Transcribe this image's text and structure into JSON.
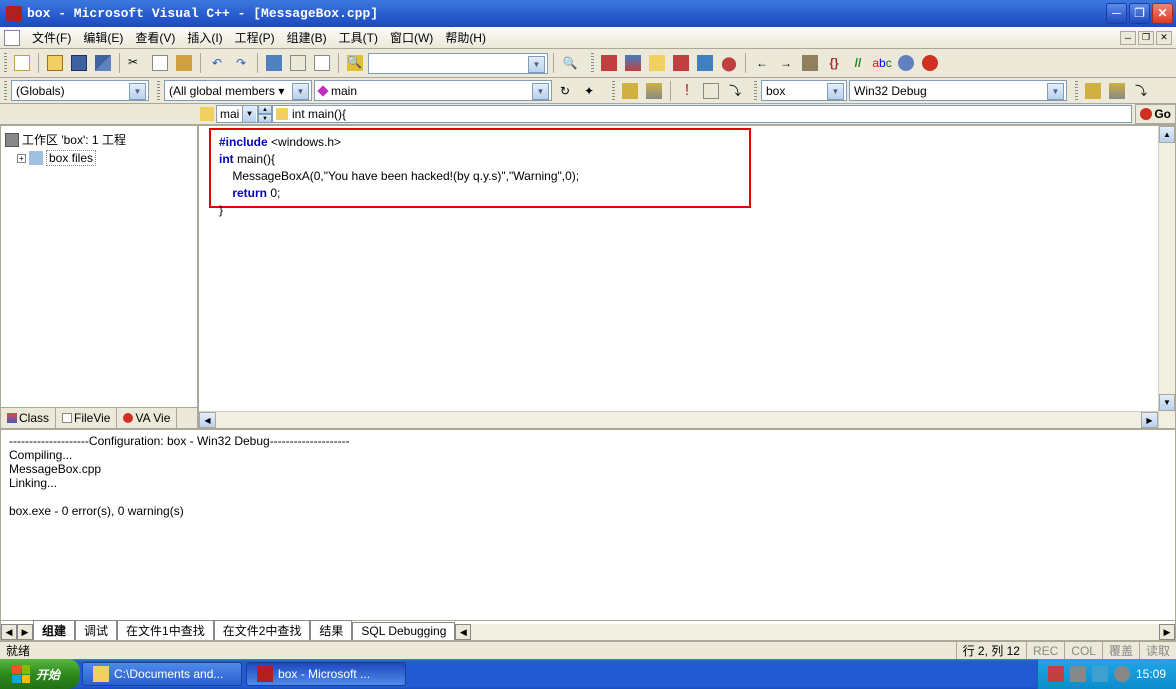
{
  "titlebar": {
    "text": "box - Microsoft Visual C++ - [MessageBox.cpp]"
  },
  "menu": {
    "file": "文件(F)",
    "edit": "编辑(E)",
    "view": "查看(V)",
    "insert": "插入(I)",
    "project": "工程(P)",
    "build": "组建(B)",
    "tools": "工具(T)",
    "window": "窗口(W)",
    "help": "帮助(H)"
  },
  "combos": {
    "scope": "(Globals)",
    "members": "(All global members ▾",
    "func": "main",
    "filter": "",
    "solution": "box",
    "config": "Win32 Debug"
  },
  "crumb": {
    "file": "mai",
    "func": "int main(){"
  },
  "go_label": "Go",
  "workspace": {
    "title": "工作区 'box': 1 工程",
    "project": "box files"
  },
  "sidebar_tabs": {
    "class": "Class",
    "file": "FileVie",
    "va": "VA Vie"
  },
  "code": {
    "l1a": "#include",
    "l1b": " <windows.h>",
    "l2a": "int",
    "l2b": " main(){",
    "l3": "    MessageBoxA(0,\"You have been hacked!(by q.y.s)\",\"Warning\",0);",
    "l4a": "    return",
    "l4b": " 0;",
    "l5": "}"
  },
  "output": "--------------------Configuration: box - Win32 Debug--------------------\nCompiling...\nMessageBox.cpp\nLinking...\n\nbox.exe - 0 error(s), 0 warning(s)",
  "output_tabs": {
    "build": "组建",
    "debug": "调试",
    "find1": "在文件1中查找",
    "find2": "在文件2中查找",
    "results": "结果",
    "sql": "SQL Debugging"
  },
  "status": {
    "ready": "就绪",
    "pos": "行 2, 列 12",
    "rec": "REC",
    "col": "COL",
    "ovr": "覆盖",
    "read": "读取"
  },
  "taskbar": {
    "start": "开始",
    "item1": "C:\\Documents and...",
    "item2": "box - Microsoft ...",
    "time": "15:09"
  }
}
